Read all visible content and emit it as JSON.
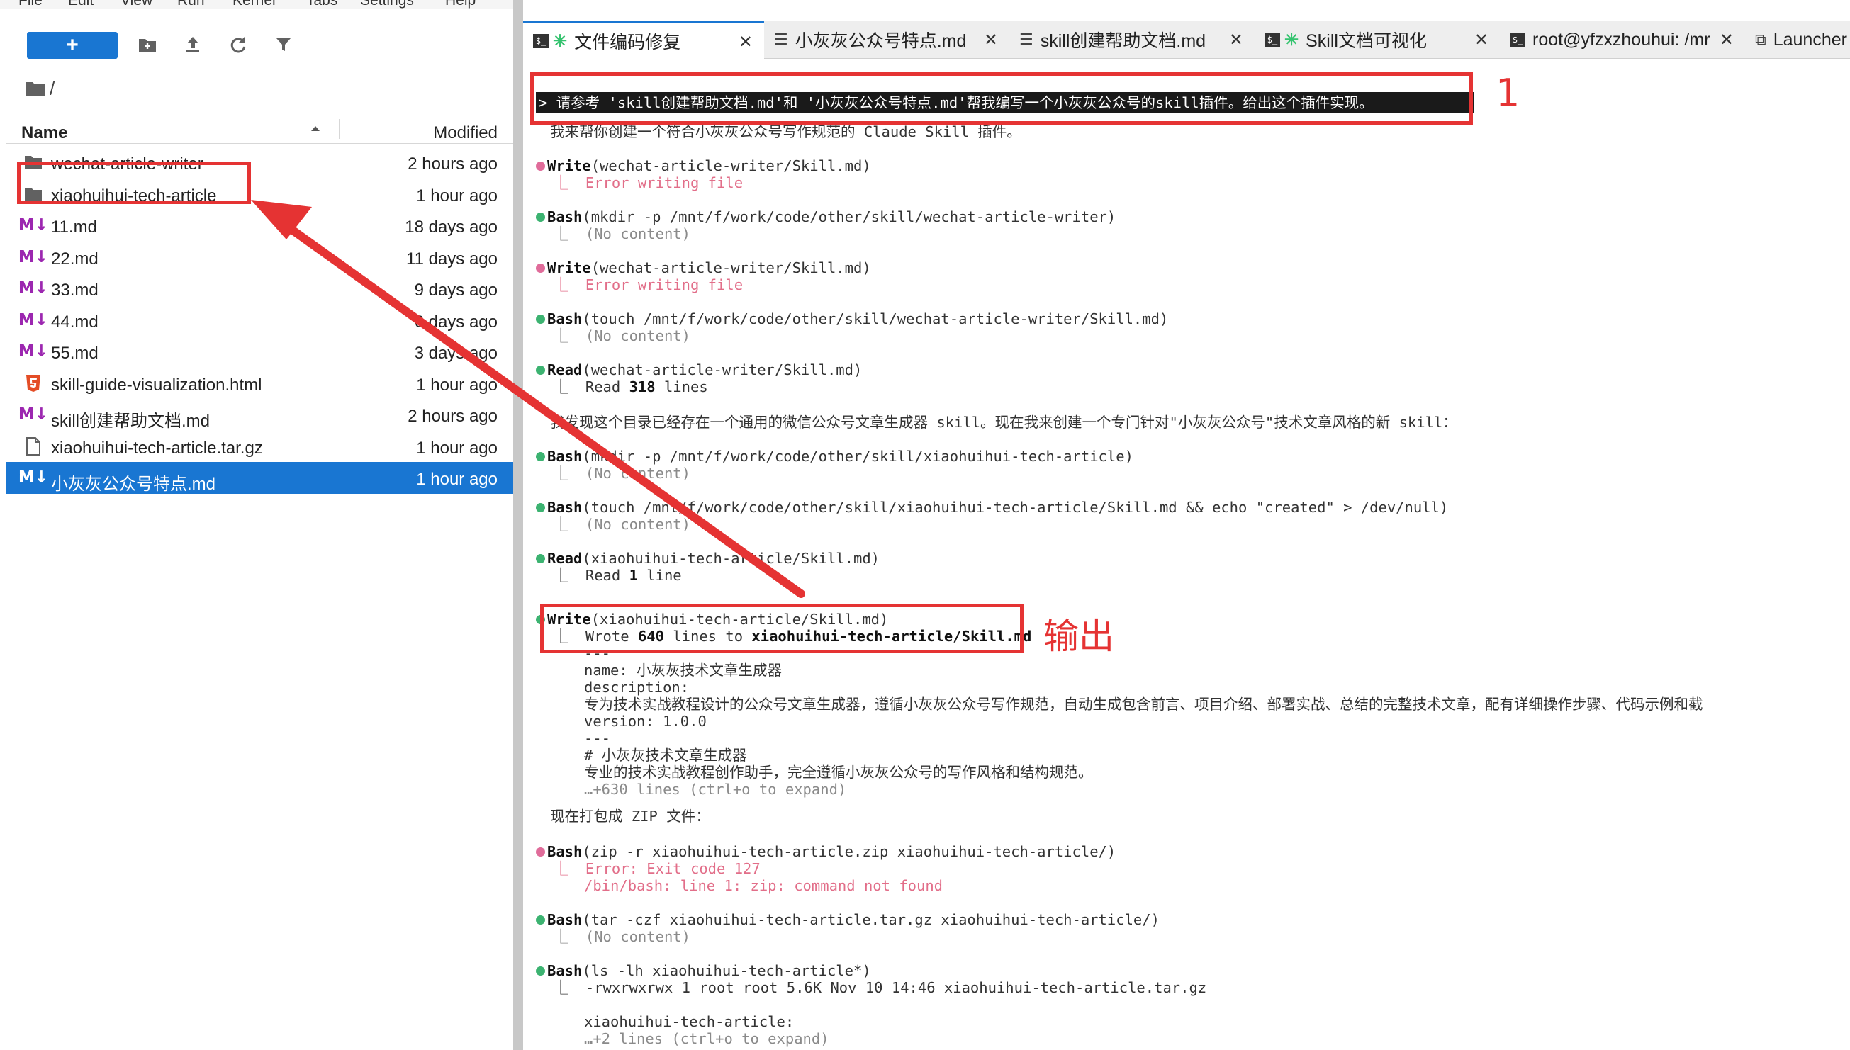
{
  "menu": [
    "File",
    "Edit",
    "View",
    "Run",
    "Kernel",
    "Tabs",
    "Settings",
    "Help"
  ],
  "toolbar": {
    "new_label": "+"
  },
  "breadcrumb": "/",
  "file_browser": {
    "header_name": "Name",
    "header_modified": "Modified",
    "files": [
      {
        "type": "folder",
        "name": "wechat-article-writer",
        "modified": "2 hours ago"
      },
      {
        "type": "folder",
        "name": "xiaohuihui-tech-article",
        "modified": "1 hour ago"
      },
      {
        "type": "md",
        "name": "11.md",
        "modified": "18 days ago"
      },
      {
        "type": "md",
        "name": "22.md",
        "modified": "11 days ago"
      },
      {
        "type": "md",
        "name": "33.md",
        "modified": "9 days ago"
      },
      {
        "type": "md",
        "name": "44.md",
        "modified": "6 days ago"
      },
      {
        "type": "md",
        "name": "55.md",
        "modified": "3 days ago"
      },
      {
        "type": "html",
        "name": "skill-guide-visualization.html",
        "modified": "1 hour ago"
      },
      {
        "type": "md",
        "name": "skill创建帮助文档.md",
        "modified": "2 hours ago"
      },
      {
        "type": "file",
        "name": "xiaohuihui-tech-article.tar.gz",
        "modified": "1 hour ago"
      },
      {
        "type": "md",
        "name": "小灰灰公众号特点.md",
        "modified": "1 hour ago",
        "selected": true
      }
    ]
  },
  "tabs": [
    {
      "label": "文件编码修复",
      "icon": "terminal-claude",
      "active": true
    },
    {
      "label": "小灰灰公众号特点.md",
      "icon": "document"
    },
    {
      "label": "skill创建帮助文档.md",
      "icon": "document"
    },
    {
      "label": "Skill文档可视化",
      "icon": "terminal-claude"
    },
    {
      "label": "root@yfzxzhouhui: /mr",
      "icon": "terminal"
    },
    {
      "label": "Launcher",
      "icon": "launcher"
    }
  ],
  "terminal": {
    "prompt": "> 请参考 'skill创建帮助文档.md'和 '小灰灰公众号特点.md'帮我编写一个小灰灰公众号的skill插件。给出这个插件实现。",
    "intro": "我来帮你创建一个符合小灰灰公众号写作规范的 Claude Skill 插件。",
    "steps": [
      {
        "bullet": "pink",
        "tool": "Write",
        "arg": "(wechat-article-writer/Skill.md)",
        "result": "Error writing file",
        "result_style": "err"
      },
      {
        "bullet": "green",
        "tool": "Bash",
        "arg": "(mkdir -p /mnt/f/work/code/other/skill/wechat-article-writer)",
        "result": "(No content)",
        "result_style": "muted"
      },
      {
        "bullet": "pink",
        "tool": "Write",
        "arg": "(wechat-article-writer/Skill.md)",
        "result": "Error writing file",
        "result_style": "err"
      },
      {
        "bullet": "green",
        "tool": "Bash",
        "arg": "(touch /mnt/f/work/code/other/skill/wechat-article-writer/Skill.md)",
        "result": "(No content)",
        "result_style": "muted"
      },
      {
        "bullet": "green",
        "tool": "Read",
        "arg": "(wechat-article-writer/Skill.md)",
        "result_pre": "Read ",
        "result_bold": "318",
        "result_post": " lines",
        "result_style": "plain"
      }
    ],
    "note": "我发现这个目录已经存在一个通用的微信公众号文章生成器 skill。现在我来创建一个专门针对\"小灰灰公众号\"技术文章风格的新 skill：",
    "steps2": [
      {
        "bullet": "green",
        "tool": "Bash",
        "arg": "(mkdir -p /mnt/f/work/code/other/skill/xiaohuihui-tech-article)",
        "result": "(No content)",
        "result_style": "muted"
      },
      {
        "bullet": "green",
        "tool": "Bash",
        "arg": "(touch /mnt/f/work/code/other/skill/xiaohuihui-tech-article/Skill.md && echo \"created\" > /dev/null)",
        "result": "(No content)",
        "result_style": "muted"
      },
      {
        "bullet": "green",
        "tool": "Read",
        "arg": "(xiaohuihui-tech-article/Skill.md)",
        "result_pre": "Read ",
        "result_bold": "1",
        "result_post": " line",
        "result_style": "plain"
      }
    ],
    "write_step": {
      "tool": "Write",
      "arg": "(xiaohuihui-tech-article/Skill.md)",
      "result_pre": "Wrote ",
      "result_count": "640",
      "result_mid": " lines to ",
      "result_path": "xiaohuihui-tech-article/Skill.md"
    },
    "skill_preview": [
      "---",
      "name: 小灰灰技术文章生成器",
      "description:",
      "专为技术实战教程设计的公众号文章生成器，遵循小灰灰公众号写作规范，自动生成包含前言、项目介绍、部署实战、总结的完整技术文章，配有详细操作步骤、代码示例和截",
      "version: 1.0.0",
      "---",
      "# 小灰灰技术文章生成器",
      "专业的技术实战教程创作助手，完全遵循小灰灰公众号的写作风格和结构规范。",
      "…+630 lines (ctrl+o to expand)"
    ],
    "zip_note": "现在打包成 ZIP 文件：",
    "zip_step": {
      "tool": "Bash",
      "arg": "(zip -r xiaohuihui-tech-article.zip xiaohuihui-tech-article/)",
      "result1": "Error: Exit code 127",
      "result2": "/bin/bash: line 1: zip: command not found"
    },
    "tar_step": {
      "tool": "Bash",
      "arg": "(tar -czf xiaohuihui-tech-article.tar.gz xiaohuihui-tech-article/)",
      "result": "(No content)"
    },
    "ls_step": {
      "tool": "Bash",
      "arg": "(ls -lh xiaohuihui-tech-article*)",
      "result1": "-rwxrwxrwx 1 root root 5.6K Nov 10 14:46 xiaohuihui-tech-article.tar.gz",
      "result2": "xiaohuihui-tech-article:",
      "result3": "…+2 lines (ctrl+o to expand)"
    }
  },
  "annotations": {
    "label_1": "1",
    "label_output": "输出",
    "color": "#e53333"
  }
}
